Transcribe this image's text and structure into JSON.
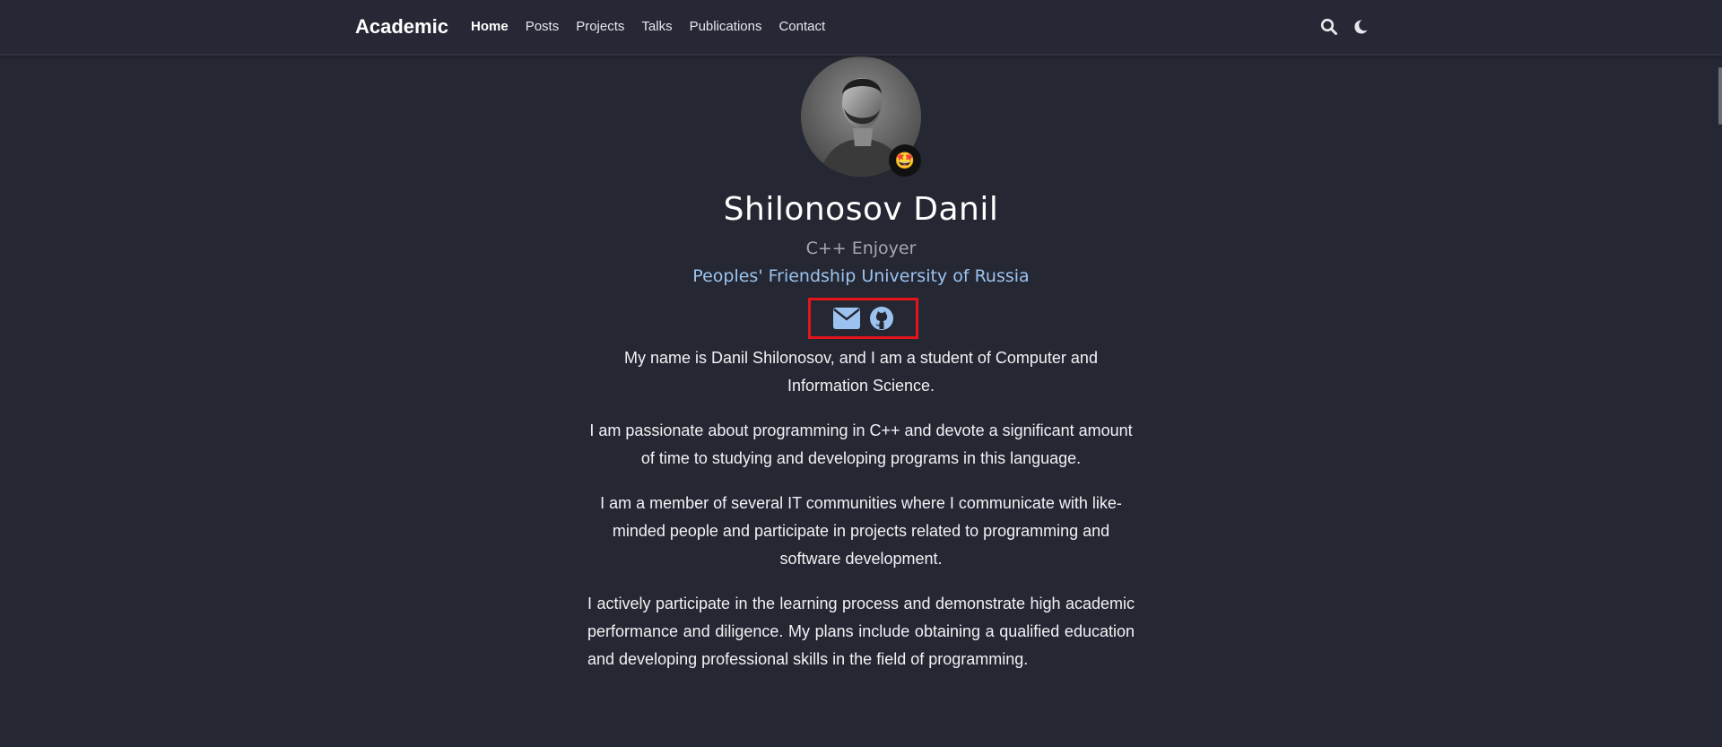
{
  "navbar": {
    "brand": "Academic",
    "links": [
      {
        "label": "Home",
        "active": true
      },
      {
        "label": "Posts"
      },
      {
        "label": "Projects"
      },
      {
        "label": "Talks"
      },
      {
        "label": "Publications"
      },
      {
        "label": "Contact"
      }
    ],
    "icons": [
      "search-icon",
      "moon-icon"
    ]
  },
  "profile": {
    "name": "Shilonosov Danil",
    "role": "C++ Enjoyer",
    "organization": "Peoples' Friendship University of Russia",
    "status_emoji": "🤩",
    "social": [
      "envelope-icon",
      "github-icon"
    ]
  },
  "bio": {
    "paragraphs": [
      "My name is Danil Shilonosov, and I am a student of Computer and Information Science.",
      "I am passionate about programming in C++ and devote a significant amount of time to studying and developing programs in this language.",
      "I am a member of several IT communities where I communicate with like-minded people and participate in projects related to programming and software development.",
      "I actively participate in the learning process and demonstrate high academic performance and diligence. My plans include obtaining a qualified education and developing professional skills in the field of programming."
    ]
  },
  "colors": {
    "background": "#252733",
    "accent_link": "#9cc3ef",
    "highlight_box": "#e3151b"
  }
}
